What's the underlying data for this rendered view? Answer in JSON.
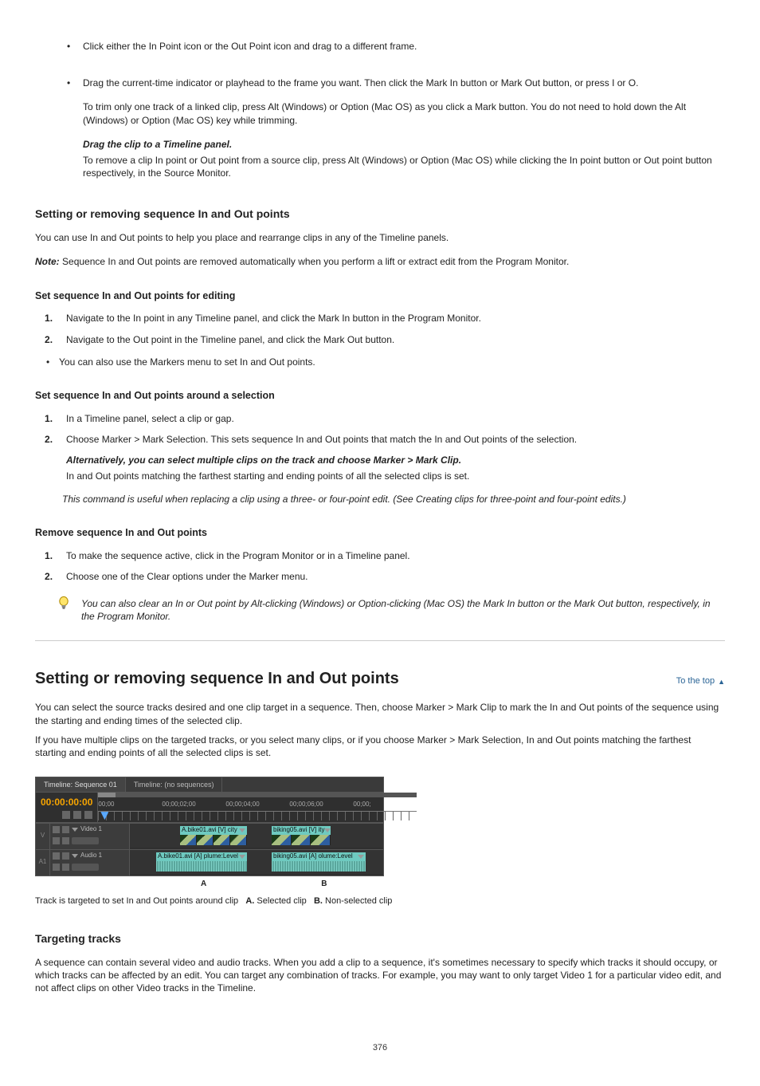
{
  "bullets_top": {
    "b1": "Click either the In Point icon or the Out Point icon and drag to a different frame.",
    "b2": "Drag the current-time indicator or playhead to the frame you want. Then click the Mark In button or Mark Out button, or press I or O."
  },
  "trim_notes": {
    "n1": "To trim only one track of a linked clip, press Alt (Windows) or Option (Mac OS) as you click a Mark button. You do not need to hold down the Alt (Windows) or Option (Mac OS) key while trimming.",
    "n2": {
      "head": "Drag the clip to a Timeline panel.",
      "body": "To remove a clip In point or Out point from a source clip, press Alt (Windows) or Option (Mac OS) while clicking the In point button or Out point button respectively, in the Source Monitor."
    }
  },
  "sec1": {
    "title": "Setting or removing sequence In and Out points",
    "p1": "You can use In and Out points to help you place and rearrange clips in any of the Timeline panels.",
    "note_label": "Note:",
    "note_body": "Sequence In and Out points are removed automatically when you perform a lift or extract edit from the Program Monitor.",
    "sub_a": "Set sequence In and Out points for editing",
    "s1": "Navigate to the In point in any Timeline panel, and click the Mark In button in the Program Monitor.",
    "s2": "Navigate to the Out point in the Timeline panel, and click the Mark Out button.",
    "single_bullet": "You can also use the Markers menu to set In and Out points.",
    "sub_b": "Set sequence In and Out points around a selection",
    "b1step": "In a Timeline panel, select a clip or gap.",
    "b2step": "Choose Marker > Mark Selection. This sets sequence In and Out points that match the In and Out points of the selection.",
    "b_alt_head": "Alternatively, you can select multiple clips on the track and choose Marker > Mark Clip.",
    "b_alt_body": "In and Out points matching the farthest starting and ending points of all the selected clips is set.",
    "tip": "This command is useful when replacing a clip using a three- or four-point edit. (See Creating clips for three-point and four-point edits.)",
    "sub_c": "Remove sequence In and Out points",
    "c1": "To make the sequence active, click in the Program Monitor or in a Timeline panel.",
    "c2": "Choose one of the Clear options under the Marker menu.",
    "tip2": "You can also clear an In or Out point by Alt-clicking (Windows) or Option-clicking (Mac OS) the Mark In button or the Mark Out button, respectively, in the Program Monitor."
  },
  "sec2": {
    "heading": "Setting or removing sequence In and Out points",
    "to_top": "To the top",
    "p1": "You can select the source tracks desired and one clip target in a sequence. Then, choose Marker > Mark Clip to mark the In and Out points of the sequence using the starting and ending times of the selected clip.",
    "p2": "If you have multiple clips on the targeted tracks, or you select many clips, or if you choose Marker > Mark Selection, In and Out points matching the farthest starting and ending points of all the selected clips is set."
  },
  "timeline": {
    "tab_active": "Timeline: Sequence 01",
    "tab_inactive": "Timeline: (no sequences)",
    "timecode": "00:00:00:00",
    "ticks": [
      "00;00",
      "00;00;02;00",
      "00;00;04;00",
      "00;00;06;00",
      "00;00;"
    ],
    "track_v_gutter": "V",
    "track_v_name": "Video 1",
    "track_a_gutter": "A1",
    "track_a_name": "Audio 1",
    "clipA_v_label": "A.bike01.avi [V] city",
    "clipB_v_label": "biking05.avi [V] ity",
    "clipA_a_label": "A.bike01.avi [A] plume:Level",
    "clipB_a_label": "biking05.avi [A] olume:Level",
    "label_A": "A",
    "label_B": "B"
  },
  "caption": {
    "lead": "Track is targeted to set In and Out points around clip",
    "segA_label": "A.",
    "segA_text": "Selected clip",
    "segB_label": "B.",
    "segB_text": "Non-selected clip"
  },
  "sec_tracks": {
    "title": "Targeting tracks",
    "p": "A sequence can contain several video and audio tracks. When you add a clip to a sequence, it's sometimes necessary to specify which tracks it should occupy, or which tracks can be affected by an edit. You can target any combination of tracks. For example, you may want to only target Video 1 for a particular video edit, and not affect clips on other Video tracks in the Timeline."
  },
  "page_number": "376"
}
